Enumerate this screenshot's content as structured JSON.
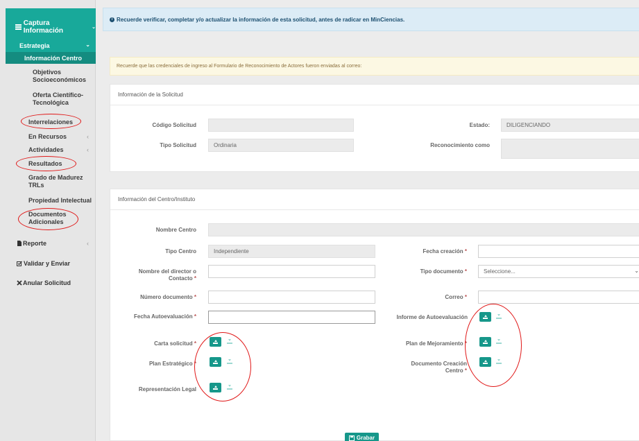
{
  "sidebar": {
    "capture": "Captura Información",
    "strategy": "Estrategia",
    "info_centro": "Información Centro",
    "items": [
      "Objetivos Socioeconómicos",
      "Oferta Científico-Tecnológica",
      "Interrelaciones",
      "En Recursos",
      "Actividades",
      "Resultados",
      "Grado de Madurez TRLs",
      "Propiedad Intelectual",
      "Documentos Adicionales"
    ],
    "reporte": "Reporte",
    "validar": "Validar y Enviar",
    "anular": "Anular Solicitud"
  },
  "alert_text": "Recuerde verificar, completar y/o actualizar la información de esta solicitud, antes de radicar en MinCiencias.",
  "warning_text": "Recuerde que las credenciales de ingreso al Formulario de Reconocimiento de Actores fueron enviadas al correo:",
  "solicitud": {
    "title": "Información de la Solicitud",
    "codigo_label": "Código Solicitud",
    "codigo_value": "",
    "estado_label": "Estado:",
    "estado_value": "DILIGENCIANDO",
    "tipo_label": "Tipo Solicitud",
    "tipo_value": "Ordinaria",
    "reconocimiento_label": "Reconocimiento como",
    "reconocimiento_value": ""
  },
  "centro": {
    "title": "Información del Centro/Instituto",
    "nombre_label": "Nombre Centro",
    "nombre_value": "",
    "tipo_label": "Tipo Centro",
    "tipo_value": "Independiente",
    "fecha_creacion_label": "Fecha creación",
    "director_label_1": "Nombre del director o",
    "director_label_2": "Contacto",
    "tipo_doc_label": "Tipo documento",
    "tipo_doc_placeholder": "Seleccione...",
    "num_doc_label": "Número documento",
    "correo_label": "Correo",
    "fecha_auto_label": "Fecha Autoevaluación",
    "informe_label": "Informe de Autoevaluación",
    "carta_label": "Carta solicitud",
    "plan_mejora_label": "Plan de Mejoramiento",
    "plan_estrategico_label": "Plan Estratégico",
    "doc_creacion_label_1": "Documento Creación",
    "doc_creacion_label_2": "Centro",
    "representacion_label": "Representación Legal",
    "required_mark": "*"
  },
  "grabar_label": "Grabar",
  "colors": {
    "accent": "#18a99a",
    "accent_dark": "#148c80",
    "annotation": "#e01616"
  }
}
